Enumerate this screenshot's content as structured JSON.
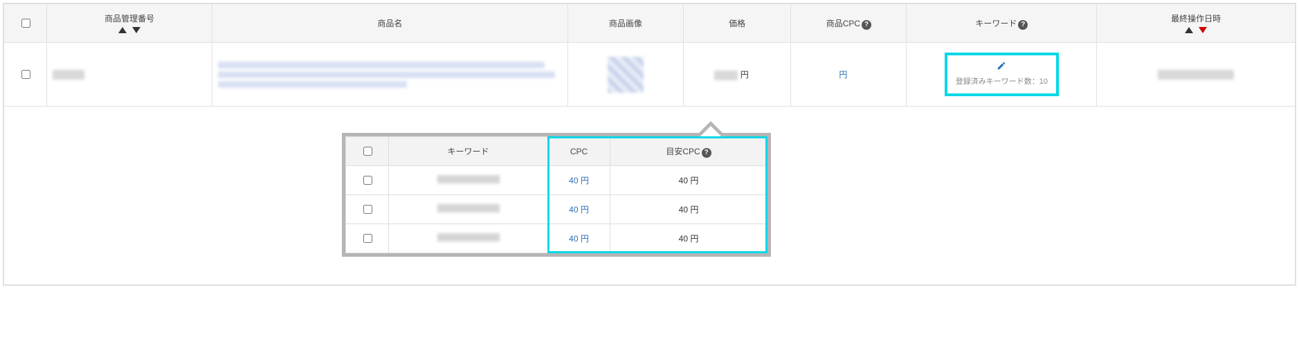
{
  "headers": {
    "product_id": "商品管理番号",
    "product_name": "商品名",
    "product_image": "商品画像",
    "price": "価格",
    "product_cpc": "商品CPC",
    "keyword": "キーワード",
    "last_op": "最終操作日時"
  },
  "row": {
    "price_currency": "円",
    "cpc_currency": "円",
    "keyword_count_label": "登録済みキーワード数：10"
  },
  "sub_headers": {
    "keyword": "キーワード",
    "cpc": "CPC",
    "est_cpc": "目安CPC"
  },
  "sub_rows": [
    {
      "cpc": "40 円",
      "est": "40 円"
    },
    {
      "cpc": "40 円",
      "est": "40 円"
    },
    {
      "cpc": "40 円",
      "est": "40 円"
    }
  ],
  "help_icon": "?"
}
